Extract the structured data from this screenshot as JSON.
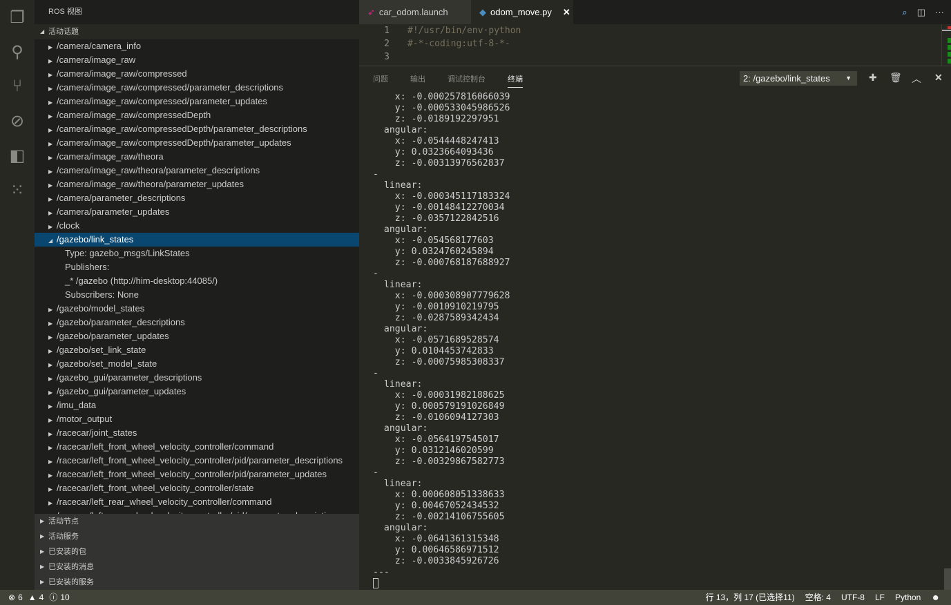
{
  "activity_bar": [
    {
      "icon": "files-icon",
      "glyph": "❐"
    },
    {
      "icon": "search-icon",
      "glyph": "⚲"
    },
    {
      "icon": "source-control-icon",
      "glyph": "⑂"
    },
    {
      "icon": "debug-icon",
      "glyph": "⊘"
    },
    {
      "icon": "extensions-icon",
      "glyph": "◧"
    },
    {
      "icon": "ros-icon",
      "glyph": "⁙"
    }
  ],
  "sidebar": {
    "title": "ROS 视图",
    "section": "活动话题",
    "topics": [
      "/camera/camera_info",
      "/camera/image_raw",
      "/camera/image_raw/compressed",
      "/camera/image_raw/compressed/parameter_descriptions",
      "/camera/image_raw/compressed/parameter_updates",
      "/camera/image_raw/compressedDepth",
      "/camera/image_raw/compressedDepth/parameter_descriptions",
      "/camera/image_raw/compressedDepth/parameter_updates",
      "/camera/image_raw/theora",
      "/camera/image_raw/theora/parameter_descriptions",
      "/camera/image_raw/theora/parameter_updates",
      "/camera/parameter_descriptions",
      "/camera/parameter_updates",
      "/clock"
    ],
    "selected": "/gazebo/link_states",
    "selected_details": [
      "Type: gazebo_msgs/LinkStates",
      "Publishers:",
      "_* /gazebo (http://him-desktop:44085/)",
      "Subscribers: None"
    ],
    "topics_after": [
      "/gazebo/model_states",
      "/gazebo/parameter_descriptions",
      "/gazebo/parameter_updates",
      "/gazebo/set_link_state",
      "/gazebo/set_model_state",
      "/gazebo_gui/parameter_descriptions",
      "/gazebo_gui/parameter_updates",
      "/imu_data",
      "/motor_output",
      "/racecar/joint_states",
      "/racecar/left_front_wheel_velocity_controller/command",
      "/racecar/left_front_wheel_velocity_controller/pid/parameter_descriptions",
      "/racecar/left_front_wheel_velocity_controller/pid/parameter_updates",
      "/racecar/left_front_wheel_velocity_controller/state",
      "/racecar/left_rear_wheel_velocity_controller/command",
      "/racecar/left_rear_wheel_velocity_controller/pid/parameter_descriptions"
    ],
    "bottom_sections": [
      "活动节点",
      "活动服务",
      "已安装的包",
      "已安装的消息",
      "已安装的服务"
    ]
  },
  "editor": {
    "tabs": [
      {
        "label": "car_odom.launch",
        "icon": "ros-launch-icon",
        "active": false
      },
      {
        "label": "odom_move.py",
        "icon": "python-icon",
        "active": true
      }
    ],
    "code_lines": [
      "#!/usr/bin/env·python",
      "#-*-coding:utf-8-*-",
      ""
    ]
  },
  "panel": {
    "tabs": [
      "问题",
      "输出",
      "调试控制台",
      "终端"
    ],
    "active_tab": "终端",
    "terminal_select": "2: /gazebo/link_states",
    "terminal_lines": [
      "    x: -0.000257816066039",
      "    y: -0.000533045986526",
      "    z: -0.0189192297951",
      "  angular:",
      "    x: -0.0544448247413",
      "    y: 0.0323664093436",
      "    z: -0.00313976562837",
      "-",
      "  linear:",
      "    x: -0.000345117183324",
      "    y: -0.00148412270034",
      "    z: -0.0357122842516",
      "  angular:",
      "    x: -0.054568177603",
      "    y: 0.0324760245894",
      "    z: -0.000768187688927",
      "-",
      "  linear:",
      "    x: -0.000308907779628",
      "    y: -0.0010910219795",
      "    z: -0.0287589342434",
      "  angular:",
      "    x: -0.0571689528574",
      "    y: 0.0104453742833",
      "    z: -0.00075985308337",
      "-",
      "  linear:",
      "    x: -0.00031982188625",
      "    y: 0.000579191026849",
      "    z: -0.0106094127303",
      "  angular:",
      "    x: -0.0564197545017",
      "    y: 0.0312146020599",
      "    z: -0.00329867582773",
      "-",
      "  linear:",
      "    x: 0.000608051338633",
      "    y: 0.00467052434532",
      "    z: -0.00214106755605",
      "  angular:",
      "    x: -0.0641361315348",
      "    y: 0.00646586971512",
      "    z: -0.0033845926726",
      "---"
    ]
  },
  "status": {
    "errors": "6",
    "warnings": "4",
    "infos": "10",
    "position": "行 13，列 17 (已选择11)",
    "spaces": "空格: 4",
    "encoding": "UTF-8",
    "eol": "LF",
    "language": "Python"
  }
}
